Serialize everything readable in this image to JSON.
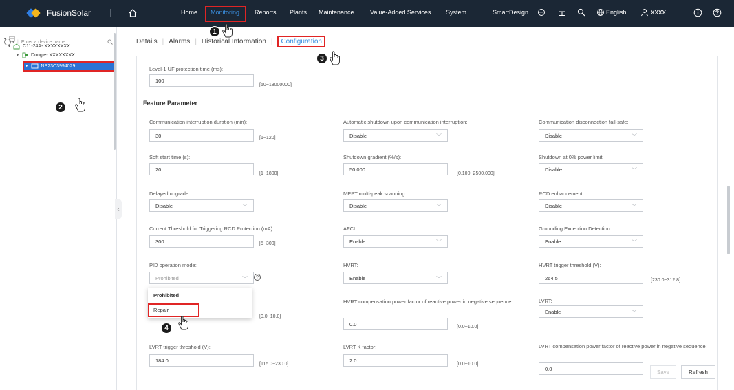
{
  "header": {
    "app_name": "FusionSolar",
    "nav": [
      "Home",
      "Monitoring",
      "Reports",
      "Plants",
      "Maintenance",
      "Value-Added Services",
      "System"
    ],
    "active_nav": "Monitoring",
    "smart_design": "SmartDesign",
    "language": "English",
    "user": "xxxx",
    "icons": [
      "home-icon",
      "chat-icon",
      "calendar-icon",
      "search-icon",
      "globe-icon",
      "user-icon",
      "info-icon",
      "help-icon"
    ]
  },
  "sidebar": {
    "search_placeholder": "Enter a device name",
    "tree": [
      {
        "label": "C11-24A- XXXXXXXX"
      },
      {
        "label": "Dongle- XXXXXXXX"
      },
      {
        "label": "NS23C3994029"
      }
    ]
  },
  "tabs": [
    "Details",
    "Alarms",
    "Historical Information",
    "Configuration"
  ],
  "active_tab": "Configuration",
  "form": {
    "top_field": {
      "label": "Level-1 UF protection time (ms):",
      "value": "100",
      "range": "[50~18000000]"
    },
    "section_title": "Feature Parameter",
    "rows": [
      {
        "c1": {
          "label": "Communication interruption duration (min):",
          "value": "30",
          "range": "[1~120]"
        },
        "c2": {
          "label": "Automatic shutdown upon communication interruption:",
          "value": "Disable"
        },
        "c3": {
          "label": "Communication disconnection fail-safe:",
          "value": "Disable"
        }
      },
      {
        "c1": {
          "label": "Soft start time (s):",
          "value": "20",
          "range": "[1~1800]"
        },
        "c2": {
          "label": "Shutdown gradient (%/s):",
          "value": "50.000",
          "range": "[0.100~2500.000]"
        },
        "c3": {
          "label": "Shutdown at 0% power limit:",
          "value": "Disable"
        }
      },
      {
        "c1": {
          "label": "Delayed upgrade:",
          "value": "Disable"
        },
        "c2": {
          "label": "MPPT multi-peak scanning:",
          "value": "Disable"
        },
        "c3": {
          "label": "RCD enhancement:",
          "value": "Disable"
        }
      },
      {
        "c1": {
          "label": "Current Threshold for Triggering RCD Protection (mA):",
          "value": "300",
          "range": "[5~300]"
        },
        "c2": {
          "label": "AFCI:",
          "value": "Enable"
        },
        "c3": {
          "label": "Grounding Exception Detection:",
          "value": "Enable"
        }
      },
      {
        "c1": {
          "label": "PID operation mode:",
          "value": "Prohibited"
        },
        "c2": {
          "label": "HVRT:",
          "value": "Enable"
        },
        "c3": {
          "label": "HVRT trigger threshold (V):",
          "value": "264.5",
          "range": "[230.0~312.8]"
        }
      },
      {
        "c1": {
          "range": "[0.0~10.0]"
        },
        "c2": {
          "label": "HVRT compensation power factor of reactive power in negative sequence:",
          "value": "0.0",
          "range": "[0.0~10.0]"
        },
        "c3": {
          "label": "LVRT:",
          "value": "Enable"
        }
      },
      {
        "c1": {
          "label": "LVRT trigger threshold (V):",
          "value": "184.0",
          "range": "[115.0~230.0]"
        },
        "c2": {
          "label": "LVRT K factor:",
          "value": "2.0",
          "range": "[0.0~10.0]"
        },
        "c3": {
          "label": "LVRT compensation power factor of reactive power in negative sequence:",
          "value": "0.0"
        }
      }
    ],
    "pid_dropdown": [
      "Prohibited",
      "Repair"
    ]
  },
  "buttons": {
    "save": "Save",
    "refresh": "Refresh"
  },
  "steps": [
    "1",
    "2",
    "3",
    "4"
  ]
}
